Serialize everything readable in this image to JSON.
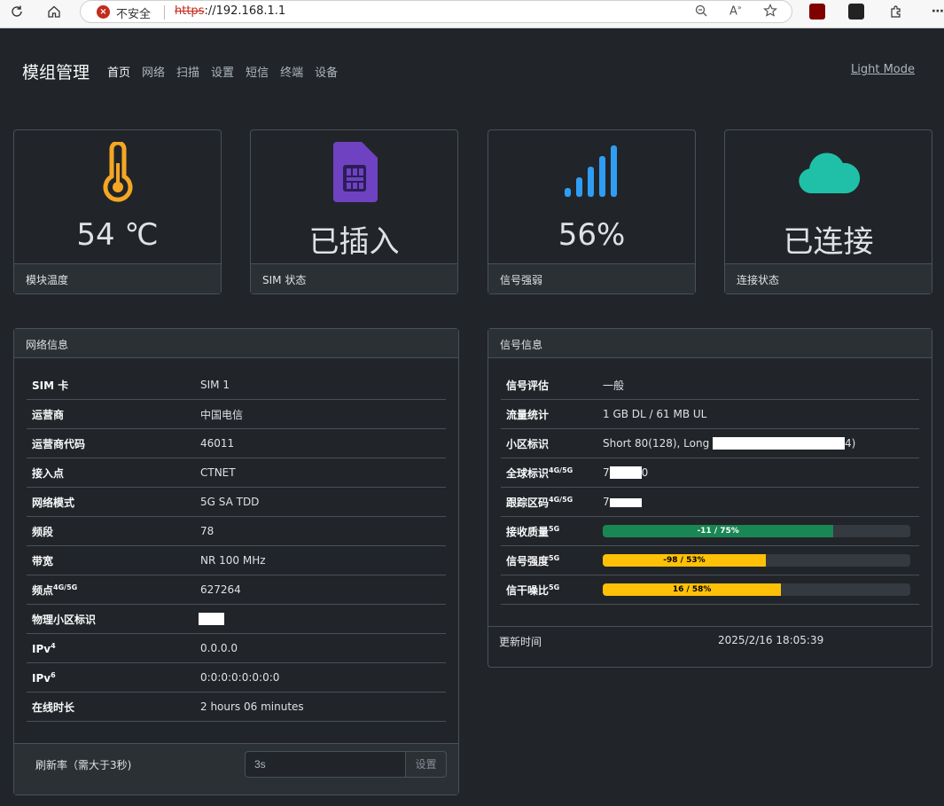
{
  "browser": {
    "insecure_label": "不安全",
    "url_scheme": "https",
    "url_rest": "://192.168.1.1"
  },
  "navbar": {
    "brand": "模组管理",
    "items": [
      "首页",
      "网络",
      "扫描",
      "设置",
      "短信",
      "终端",
      "设备"
    ],
    "active_index": 0,
    "theme_toggle": "Light Mode"
  },
  "stats": [
    {
      "icon": "thermometer-icon",
      "value": "54 ℃",
      "label": "模块温度",
      "color": "#f5a623"
    },
    {
      "icon": "sim-card-icon",
      "value": "已插入",
      "label": "SIM 状态",
      "color": "#6f42c1"
    },
    {
      "icon": "signal-bars-icon",
      "value": "56%",
      "label": "信号强弱",
      "color": "#2f9df4"
    },
    {
      "icon": "cloud-icon",
      "value": "已连接",
      "label": "连接状态",
      "color": "#20c0a8"
    }
  ],
  "network": {
    "title": "网络信息",
    "rows": [
      {
        "key": "SIM 卡",
        "value": "SIM 1"
      },
      {
        "key": "运营商",
        "value": "中国电信"
      },
      {
        "key": "运营商代码",
        "value": "46011"
      },
      {
        "key": "接入点",
        "value": "CTNET"
      },
      {
        "key": "网络模式",
        "value": "5G SA TDD"
      },
      {
        "key": "频段",
        "value": "78"
      },
      {
        "key": "带宽",
        "value": "NR 100 MHz"
      },
      {
        "key": "频点",
        "key_sup": "4G/5G",
        "value": "627264"
      },
      {
        "key": "物理小区标识",
        "value": ""
      },
      {
        "key": "IPv",
        "key_sup": "4",
        "value": "0.0.0.0"
      },
      {
        "key": "IPv",
        "key_sup": "6",
        "value": "0:0:0:0:0:0:0:0"
      },
      {
        "key": "在线时长",
        "value": "2 hours 06 minutes"
      }
    ],
    "refresh_label": "刷新率（需大于3秒)",
    "refresh_value": "3s",
    "refresh_button": "设置"
  },
  "signal": {
    "title": "信号信息",
    "rows": [
      {
        "key": "信号评估",
        "value": "一般"
      },
      {
        "key": "流量统计",
        "value": "1 GB DL / 61 MB UL"
      },
      {
        "key": "小区标识",
        "value_pre": "Short 80(128), Long ",
        "value_post": "4)"
      },
      {
        "key": "全球标识",
        "key_sup": "4G/5G",
        "value_pre": "7",
        "value_post": "0"
      },
      {
        "key": "跟踪区码",
        "key_sup": "4G/5G",
        "value_pre": "7",
        "value_post": ""
      }
    ],
    "bars": [
      {
        "key": "接收质量",
        "key_sup": "5G",
        "label": "-11 / 75%",
        "percent": 75,
        "color": "#198754"
      },
      {
        "key": "信号强度",
        "key_sup": "5G",
        "label": "-98 / 53%",
        "percent": 53,
        "color": "#ffc107"
      },
      {
        "key": "信干噪比",
        "key_sup": "5G",
        "label": "16 / 58%",
        "percent": 58,
        "color": "#ffc107"
      }
    ],
    "updated_label": "更新时间",
    "updated_value": "2025/2/16 18:05:39"
  }
}
